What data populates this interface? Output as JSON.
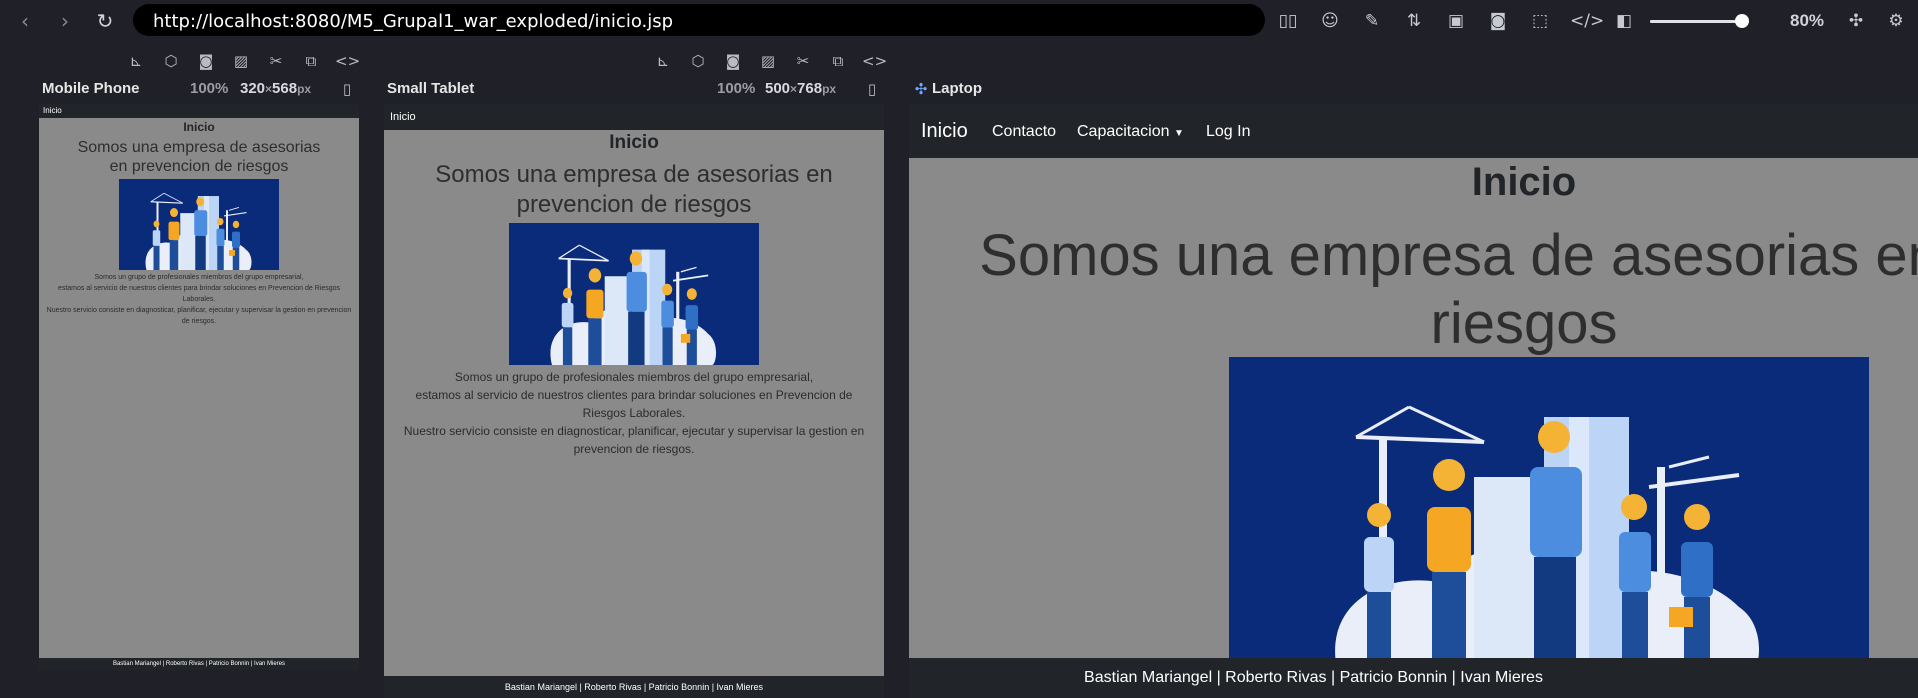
{
  "browser": {
    "url": "http://localhost:8080/M5_Grupal1_war_exploded/inicio.jsp",
    "zoom": "80%"
  },
  "devices": [
    {
      "name": "Mobile Phone",
      "zoom": "100%",
      "width": "320",
      "height": "568",
      "unit": "px"
    },
    {
      "name": "Small Tablet",
      "zoom": "100%",
      "width": "500",
      "height": "768",
      "unit": "px"
    },
    {
      "name": "Laptop"
    }
  ],
  "site": {
    "brand": "Inicio",
    "nav": {
      "contacto": "Contacto",
      "capacitacion": "Capacitacion",
      "login": "Log In"
    },
    "title": "Inicio",
    "subtitle": "Somos una empresa de asesorias en prevencion de riesgos",
    "laptop_subtitle_line1": "Somos una empresa de asesorias en prev",
    "laptop_subtitle_line2": "riesgos",
    "p1": "Somos un grupo de profesionales miembros del grupo empresarial,",
    "p2": "estamos al servicio de nuestros clientes para brindar soluciones en Prevencion de Riesgos Laborales.",
    "p3": "Nuestro servicio consiste en diagnosticar, planificar, ejecutar y supervisar la gestion en prevencion de riesgos.",
    "footer": "Bastian Mariangel | Roberto Rivas | Patricio Bonnin | Ivan Mieres"
  },
  "colors": {
    "page_bg": "#8a8a8a",
    "navbar": "#212529",
    "illustration_bg": "#0a2a7a",
    "chrome_bg": "#202128"
  }
}
